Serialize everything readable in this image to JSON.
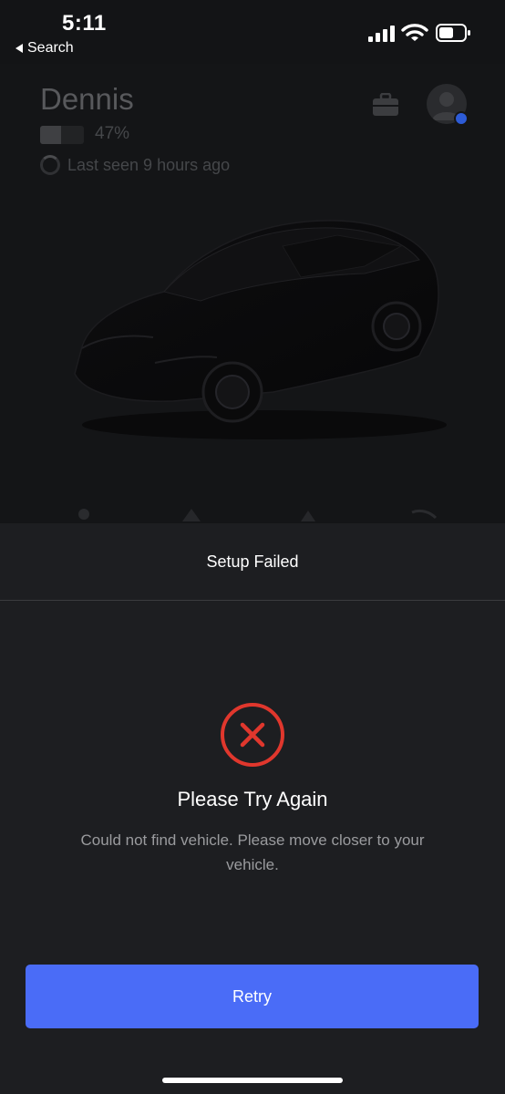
{
  "status_bar": {
    "time": "5:11",
    "back_label": "Search",
    "icons": [
      "cellular-signal-icon",
      "wifi-icon",
      "battery-icon"
    ]
  },
  "vehicle": {
    "name": "Dennis",
    "battery_percent_label": "47%",
    "battery_level": 0.47,
    "last_seen": "Last seen 9 hours ago",
    "header_icons": [
      "toolbox-icon",
      "profile-avatar"
    ]
  },
  "sheet": {
    "title": "Setup Failed",
    "error_icon": "error-x-circle-icon",
    "error_title": "Please Try Again",
    "error_message": "Could not find vehicle. Please move closer to your vehicle.",
    "retry_label": "Retry"
  },
  "colors": {
    "accent": "#4a6cf7",
    "error": "#e0372d",
    "sheet_bg": "#1d1e21",
    "page_bg": "#131416"
  }
}
